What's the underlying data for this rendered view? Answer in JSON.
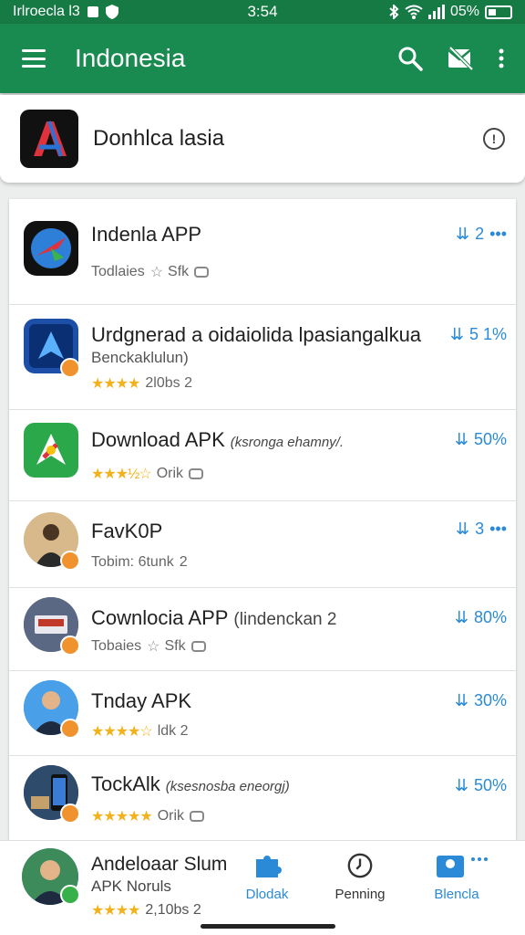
{
  "status_bar": {
    "carrier": "Irlroecla l3",
    "time": "3:54",
    "battery": "05%"
  },
  "app_bar": {
    "title": "Indonesia",
    "icons": [
      "menu-icon",
      "search-icon",
      "mail-off-icon",
      "more-vert-icon"
    ]
  },
  "featured": {
    "name": "Donhlca lasia",
    "icon": "app-logo-icon",
    "info_icon": "info-icon"
  },
  "apps": [
    {
      "title": "Indenla APP",
      "title_extra": "",
      "subtitle": "",
      "meta": "Todlaies",
      "stars": 0,
      "star_text": "☆",
      "meta2": "Sfk",
      "chat": true,
      "right": "2",
      "right_extra": "•••"
    },
    {
      "title": "Urdgnerad a oidaiolida lpasiangalkua",
      "title_extra": "",
      "subtitle": "Benckaklulun)",
      "meta": "",
      "stars": 4,
      "star_text": "★★★★",
      "meta2": "2l0bs  2",
      "chat": false,
      "right": "5 1%",
      "right_extra": ""
    },
    {
      "title": "Download APK",
      "title_extra": "(ksronga ehamny/.",
      "subtitle": "",
      "meta": "",
      "stars": 3,
      "star_text": "★★★½☆",
      "meta2": "Orik",
      "chat": true,
      "right": "50%",
      "right_extra": ""
    },
    {
      "title": "FavK0P",
      "title_extra": "",
      "subtitle": "",
      "meta": "Tobim: 6tunk",
      "stars": 0,
      "star_text": "",
      "meta2": "2",
      "chat": false,
      "right": "3",
      "right_extra": "•••"
    },
    {
      "title": "Cownlocia APP",
      "title_extra": "(lindenckan 2",
      "subtitle": "",
      "meta": "Tobaies",
      "stars": 0,
      "star_text": "☆",
      "meta2": "Sfk",
      "chat": true,
      "right": "80%",
      "right_extra": ""
    },
    {
      "title": "Tnday APK",
      "title_extra": "",
      "subtitle": "",
      "meta": "",
      "stars": 4,
      "star_text": "★★★★☆",
      "meta2": "ldk  2",
      "chat": false,
      "right": "30%",
      "right_extra": ""
    },
    {
      "title": "TockAlk",
      "title_extra": "(ksesnosba eneorgj)",
      "subtitle": "",
      "meta": "",
      "stars": 4,
      "star_text": "★★★★★",
      "meta2": "Orik",
      "chat": true,
      "right": "50%",
      "right_extra": ""
    }
  ],
  "bottom_app": {
    "title": "Andeloaar Slum",
    "subtitle": "APK Noruls",
    "star_text": "★★★★",
    "meta": "2,10bs  2"
  },
  "bottom_nav": [
    {
      "label": "Dlodak",
      "icon": "puzzle-icon",
      "color": "#2a8ad8"
    },
    {
      "label": "Penning",
      "icon": "clock-icon",
      "color": "#333333"
    },
    {
      "label": "Blencla",
      "icon": "image-icon",
      "color": "#2a8ad8"
    }
  ],
  "colors": {
    "primary": "#1a8b50",
    "status": "#167a45",
    "accent": "#2a8ad8",
    "star": "#f2b21b"
  }
}
